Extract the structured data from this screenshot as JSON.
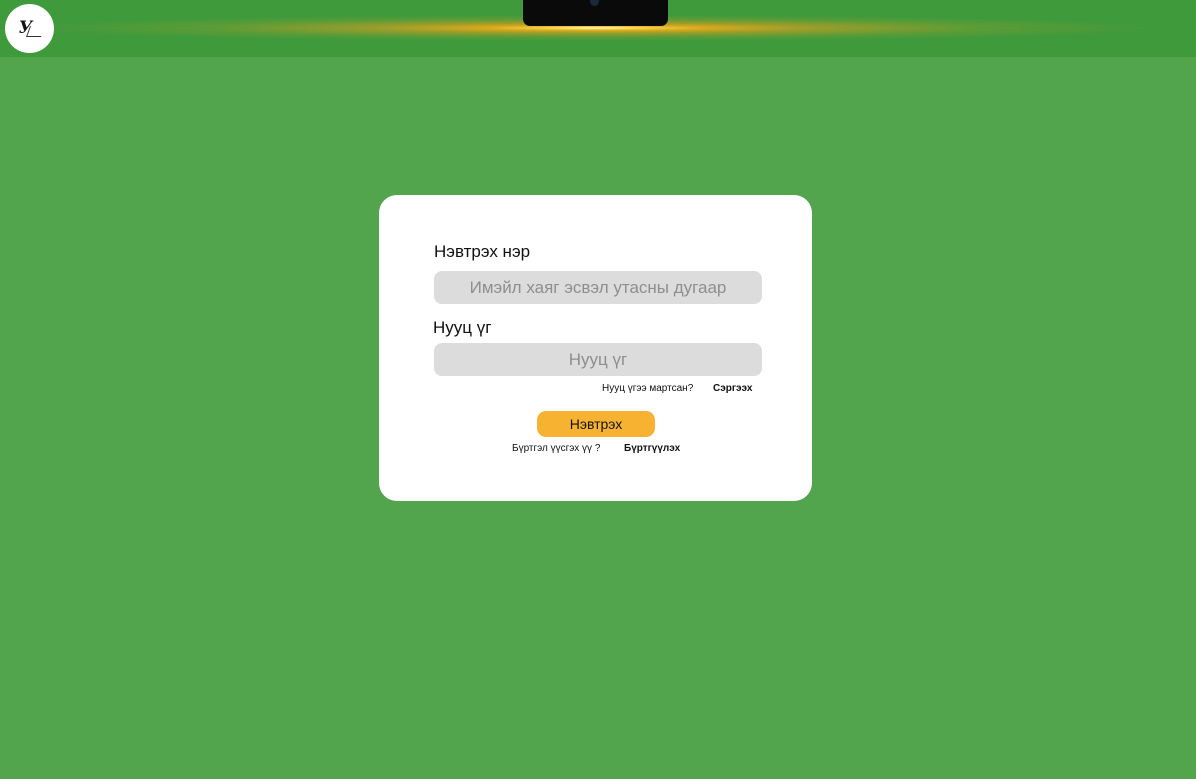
{
  "header": {
    "background_color": "#3f9a3c",
    "glow_color": "#f5aa14",
    "logo": {
      "mark": "У",
      "caption": "",
      "icon": "brand-logo-icon"
    }
  },
  "page": {
    "background_color": "#52a54d"
  },
  "login_form": {
    "username_label": "Нэвтрэх нэр",
    "username_placeholder": "Имэйл хаяг эсвэл утасны дугаар",
    "username_value": "",
    "password_label": "Нууц үг",
    "password_placeholder": "Нууц үг",
    "password_value": "",
    "forgot_text": "Нууц үгээ мартсан?",
    "restore_link": "Сэргээх",
    "login_button": "Нэвтрэх",
    "login_button_color": "#f8b232",
    "signup_question": "Бүртгэл үүсгэх үү ?",
    "signup_link": "Бүртгүүлэх"
  }
}
